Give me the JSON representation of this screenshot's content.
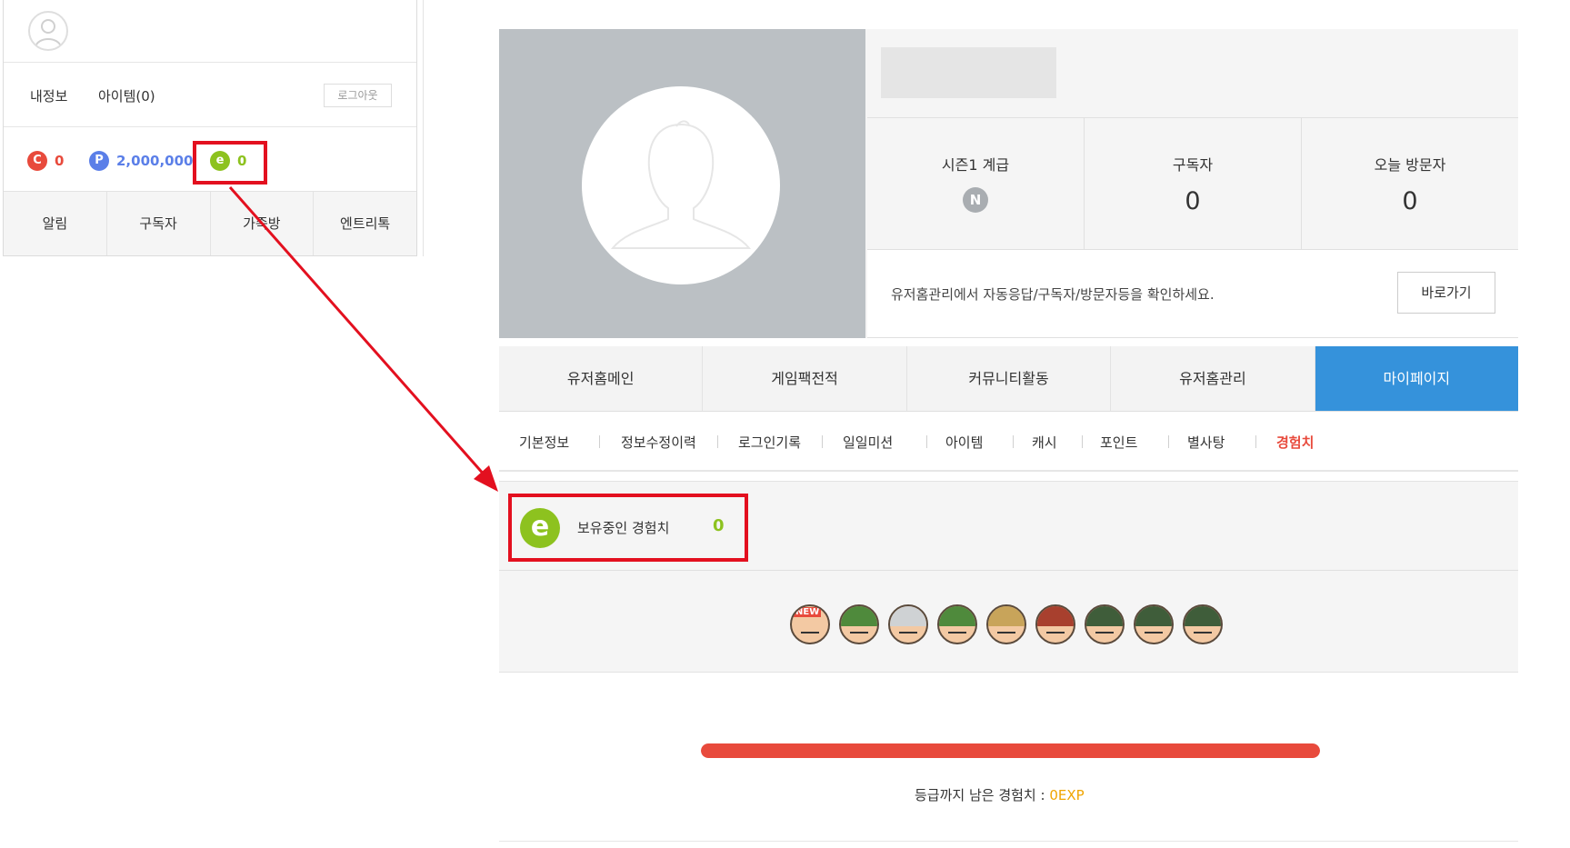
{
  "left_panel": {
    "links": [
      "내정보",
      "아이템(0)"
    ],
    "logout_label": "로그아웃",
    "currencies": [
      {
        "icon": "C",
        "value": "0",
        "color": "#e84a3c"
      },
      {
        "icon": "P",
        "value": "2,000,000",
        "color": "#5b7fe8"
      },
      {
        "icon": "e",
        "value": "0",
        "color": "#8dc21f"
      }
    ],
    "tabs": [
      "알림",
      "구독자",
      "가족방",
      "엔트리톡"
    ]
  },
  "profile": {
    "stats": [
      {
        "label": "시즌1 계급",
        "badge": "N"
      },
      {
        "label": "구독자",
        "value": "0"
      },
      {
        "label": "오늘 방문자",
        "value": "0"
      }
    ],
    "manage_text": "유저홈관리에서 자동응답/구독자/방문자등을 확인하세요.",
    "manage_button": "바로가기"
  },
  "nav": {
    "items": [
      "유저홈메인",
      "게임팩전적",
      "커뮤니티활동",
      "유저홈관리",
      "마이페이지"
    ],
    "active": "마이페이지",
    "active_color": "#3592db"
  },
  "subnav": {
    "items": [
      "기본정보",
      "정보수정이력",
      "로그인기록",
      "일일미션",
      "아이템",
      "캐시",
      "포인트",
      "별사탕",
      "경험치"
    ],
    "active": "경험치"
  },
  "exp": {
    "icon": "e",
    "label": "보유중인 경험치",
    "value": "0",
    "rank_badge": "NEW",
    "rank_count": 9,
    "progress": 1.0,
    "remain_label": "등급까지 남은 경험치 : ",
    "remain_value": "0EXP"
  },
  "colors": {
    "accent": "#3592db",
    "exp_green": "#8dc21f",
    "progress_red": "#e84a3c",
    "annotation_red": "#e3101f"
  }
}
